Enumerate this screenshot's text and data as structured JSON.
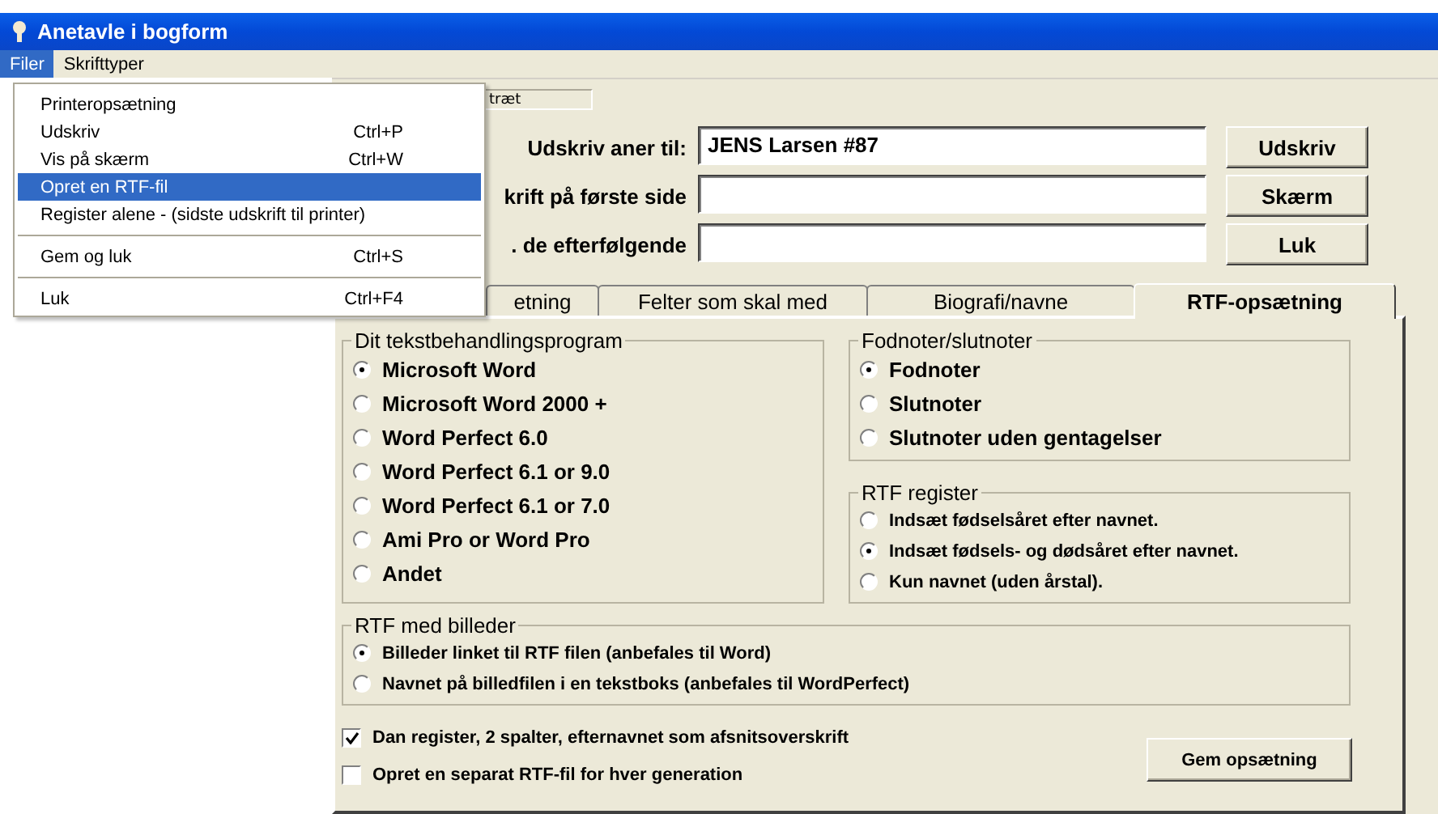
{
  "window": {
    "title": "Anetavle i bogform"
  },
  "menubar": [
    {
      "label": "Filer",
      "selected": true
    },
    {
      "label": "Skrifttyper",
      "selected": false
    }
  ],
  "file_menu": [
    {
      "kind": "item",
      "label": "Printeropsætning",
      "selected": false
    },
    {
      "kind": "item",
      "label": "Udskriv",
      "shortcut": "Ctrl+P",
      "selected": false
    },
    {
      "kind": "item",
      "label": "Vis på skærm",
      "shortcut": "Ctrl+W",
      "selected": false
    },
    {
      "kind": "item",
      "label": "Opret en RTF-fil",
      "selected": true
    },
    {
      "kind": "item",
      "label": "Register alene - (sidste udskrift til printer)",
      "selected": false
    },
    {
      "kind": "separator"
    },
    {
      "kind": "item",
      "label": "Gem og luk",
      "shortcut": "Ctrl+S",
      "selected": false
    },
    {
      "kind": "separator"
    },
    {
      "kind": "item",
      "label": "Luk",
      "shortcut": "Ctrl+F4",
      "selected": false
    }
  ],
  "partial_field": {
    "text": "træt"
  },
  "fields": [
    {
      "label": "Udskriv aner til:",
      "value": "JENS Larsen  #87"
    },
    {
      "label": "krift på første side"
    },
    {
      "label": ". de efterfølgende"
    }
  ],
  "buttons": [
    "Udskriv",
    "Skærm",
    "Luk"
  ],
  "tabs": [
    {
      "label": "etning",
      "selected": false
    },
    {
      "label": "Felter som skal med",
      "selected": false
    },
    {
      "label": "Biografi/navne",
      "selected": false
    },
    {
      "label": "RTF-opsætning",
      "selected": true
    }
  ],
  "panel": {
    "groups": [
      {
        "title": "Dit tekstbehandlingsprogram",
        "kind": "large",
        "options": [
          {
            "label": "Microsoft Word",
            "selected": true
          },
          {
            "label": "Microsoft Word 2000 +",
            "selected": false
          },
          {
            "label": "Word Perfect 6.0",
            "selected": false
          },
          {
            "label": "Word Perfect 6.1 or 9.0",
            "selected": false
          },
          {
            "label": "Word Perfect 6.1 or 7.0",
            "selected": false
          },
          {
            "label": "Ami Pro or Word Pro",
            "selected": false
          },
          {
            "label": "Andet",
            "selected": false
          }
        ]
      },
      {
        "title": "Fodnoter/slutnoter",
        "kind": "large",
        "options": [
          {
            "label": "Fodnoter",
            "selected": true
          },
          {
            "label": "Slutnoter",
            "selected": false
          },
          {
            "label": "Slutnoter uden gentagelser",
            "selected": false
          }
        ]
      },
      {
        "title": "RTF register",
        "kind": "compact",
        "options": [
          {
            "label": "Indsæt fødselsåret efter navnet.",
            "selected": false
          },
          {
            "label": "Indsæt fødsels- og dødsåret efter navnet.",
            "selected": true
          },
          {
            "label": "Kun navnet (uden årstal).",
            "selected": false
          }
        ]
      },
      {
        "title": "RTF med billeder",
        "kind": "compact",
        "options": [
          {
            "label": "Billeder linket til RTF filen (anbefales til Word)",
            "selected": true
          },
          {
            "label": "Navnet på billedfilen i en tekstboks (anbefales til WordPerfect)",
            "selected": false
          }
        ]
      }
    ],
    "checkboxes": [
      {
        "label": "Dan register, 2 spalter, efternavnet som afsnitsoverskrift",
        "checked": true
      },
      {
        "label": "Opret en separat RTF-fil for hver generation",
        "checked": false
      }
    ],
    "save_button": "Gem opsætning"
  }
}
